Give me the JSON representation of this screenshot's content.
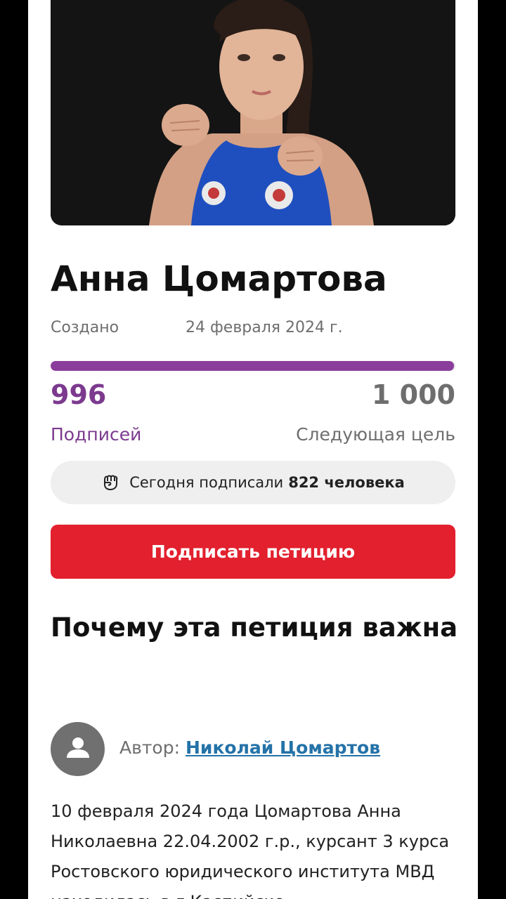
{
  "petition": {
    "title": "Анна Цомартова",
    "created_label": "Создано",
    "created_date": "24 февраля 2024 г.",
    "progress_fraction": 0.996
  },
  "stats": {
    "count": "996",
    "count_label": "Подписей",
    "goal": "1 000",
    "goal_label": "Следующая цель"
  },
  "today": {
    "prefix": "Сегодня подписали",
    "count": "822 человека",
    "icon": "fist-icon"
  },
  "sign_button": {
    "label": "Подписать петицию"
  },
  "why": {
    "heading": "Почему эта петиция важна"
  },
  "author": {
    "label": "Автор:",
    "name": "Николай Цомартов",
    "icon": "user-icon"
  },
  "body": {
    "text": "10 февраля 2024 года Цомартова Анна Николаевна 22.04.2002 г.р., курсант 3 курса Ростовского юридического института МВД находилась в г.Каспийске"
  },
  "colors": {
    "accent_purple": "#7c3a8f",
    "button_red": "#e2202e",
    "link_blue": "#2472a8"
  }
}
